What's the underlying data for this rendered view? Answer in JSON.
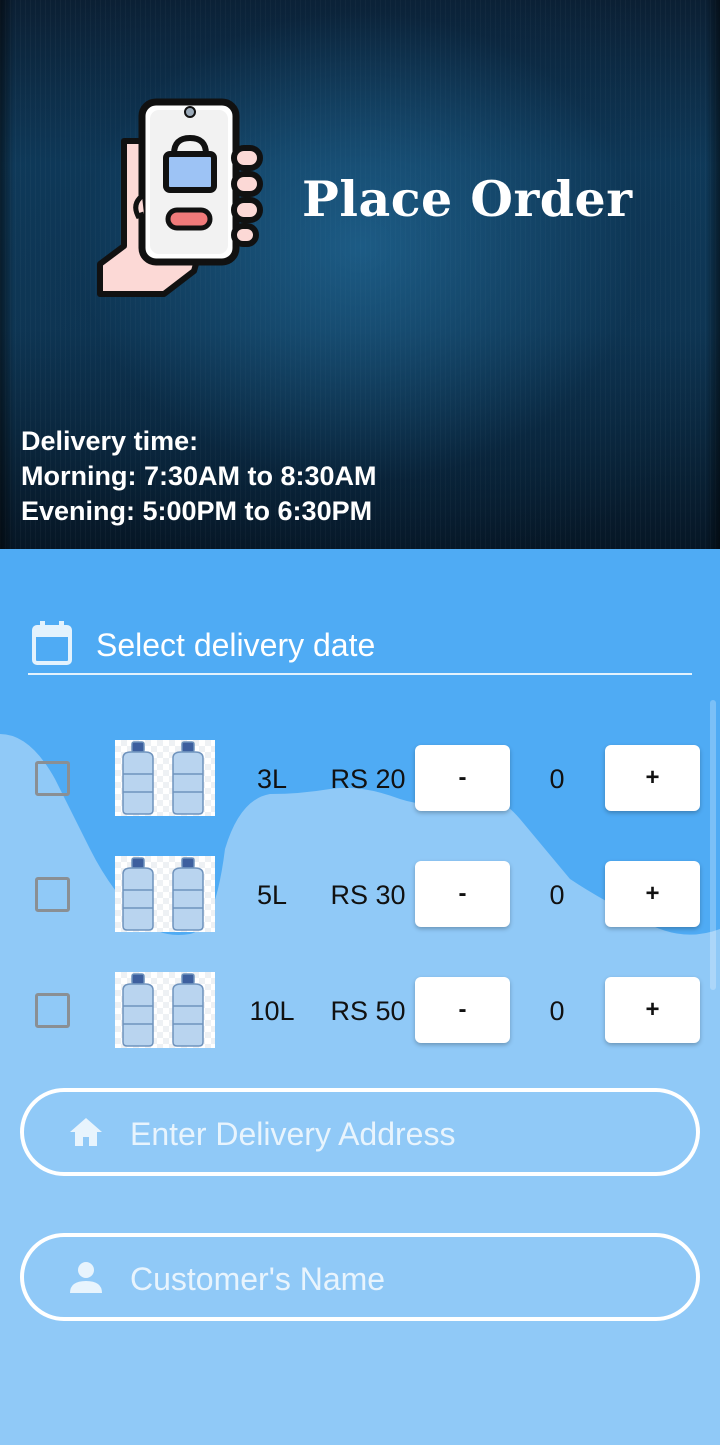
{
  "header": {
    "title": "Place Order",
    "logo_icon": "phone-shopping-hand-icon",
    "delivery_info": {
      "heading": "Delivery time:",
      "morning": "Morning: 7:30AM to 8:30AM",
      "evening": "Evening: 5:00PM to 6:30PM"
    }
  },
  "form": {
    "date_field": {
      "icon": "calendar-icon",
      "label": "Select delivery date"
    },
    "products": [
      {
        "size": "3L",
        "price": "RS 20",
        "quantity": "0",
        "minus_label": "-",
        "plus_label": "+",
        "image": "water-bottles-icon"
      },
      {
        "size": "5L",
        "price": "RS 30",
        "quantity": "0",
        "minus_label": "-",
        "plus_label": "+",
        "image": "water-bottles-icon"
      },
      {
        "size": "10L",
        "price": "RS 50",
        "quantity": "0",
        "minus_label": "-",
        "plus_label": "+",
        "image": "water-bottles-icon"
      }
    ],
    "address_field": {
      "icon": "home-icon",
      "placeholder": "Enter Delivery Address"
    },
    "name_field": {
      "icon": "person-icon",
      "placeholder": "Customer's Name"
    }
  },
  "colors": {
    "form_background": "#90c9f7",
    "wave_blue": "#4fabf4",
    "header_dark": "#0e3654"
  }
}
